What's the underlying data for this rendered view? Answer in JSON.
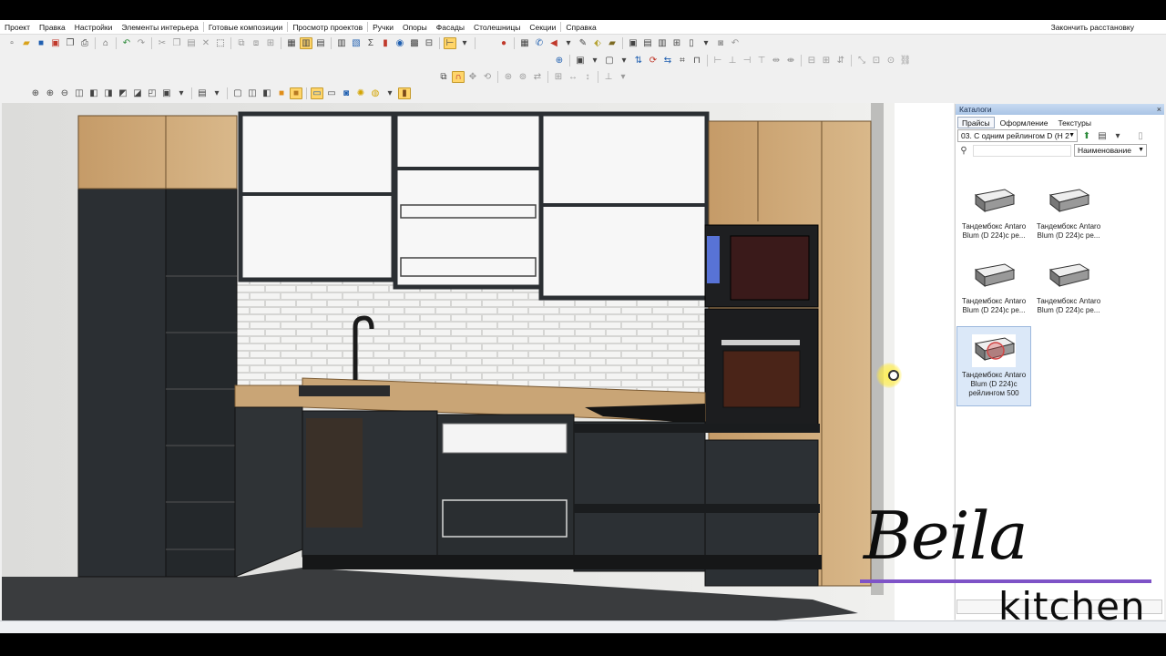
{
  "menu": {
    "items": [
      "Проект",
      "Правка",
      "Настройки",
      "Элементы интерьера",
      "Готовые композиции",
      "Просмотр проектов",
      "Ручки",
      "Опоры",
      "Фасады",
      "Столешницы",
      "Секции",
      "Справка"
    ],
    "right_action": "Закончить расстановку"
  },
  "catalog": {
    "title": "Каталоги",
    "close": "×",
    "tabs": [
      "Прайсы",
      "Оформление",
      "Текстуры"
    ],
    "active_tab": "Прайсы",
    "filter_value": "03. С одним рейлингом D (H 2",
    "sort_value": "Наименование",
    "items": [
      {
        "name": "Тандембокс Antaro Blum (D 224)c ре..."
      },
      {
        "name": "Тандембокс Antaro Blum (D 224)c ре..."
      },
      {
        "name": "Тандембокс Antaro Blum (D 224)c ре..."
      },
      {
        "name": "Тандембокс Antaro Blum (D 224)c ре..."
      },
      {
        "name": "Тандембокс Antaro Blum (D 224)с рейлингом 500",
        "selected": true
      }
    ]
  },
  "watermark": {
    "script": "Beila",
    "word": "kitchen",
    "line_color": "#7e53c7"
  },
  "colors": {
    "cabinet_dark": "#2b2f33",
    "wood": "#c9a576",
    "wall": "#e9e9e7",
    "floor": "#3a3c3e",
    "panel_title": "#b6cdea"
  }
}
